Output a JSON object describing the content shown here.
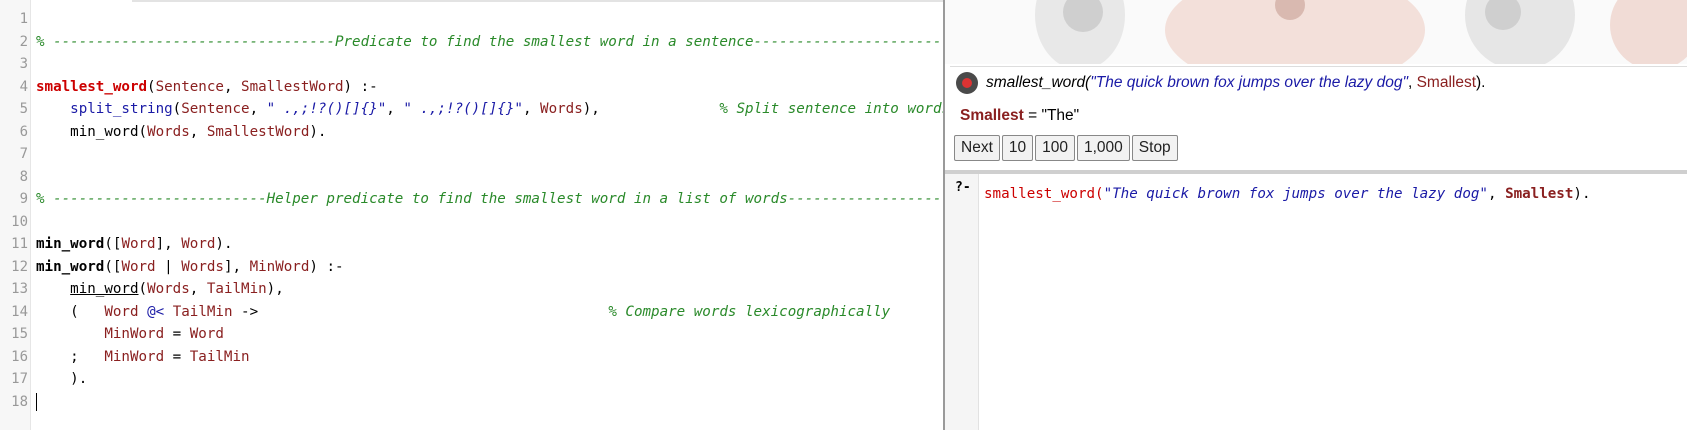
{
  "editor": {
    "lines": [
      {
        "n": "1",
        "segs": []
      },
      {
        "n": "2",
        "segs": [
          {
            "t": "% ---------------------------------Predicate to find the smallest word in a sentence-----------------------------------------",
            "c": "cm"
          }
        ]
      },
      {
        "n": "3",
        "segs": []
      },
      {
        "n": "4",
        "segs": [
          {
            "t": "smallest_word",
            "c": "hd"
          },
          {
            "t": "(",
            "c": "pl"
          },
          {
            "t": "Sentence",
            "c": "var"
          },
          {
            "t": ", ",
            "c": "pl"
          },
          {
            "t": "SmallestWord",
            "c": "var"
          },
          {
            "t": ") :-",
            "c": "pl"
          }
        ]
      },
      {
        "n": "5",
        "segs": [
          {
            "t": "    ",
            "c": "pl"
          },
          {
            "t": "split_string",
            "c": "bi"
          },
          {
            "t": "(",
            "c": "pl"
          },
          {
            "t": "Sentence",
            "c": "var"
          },
          {
            "t": ", ",
            "c": "pl"
          },
          {
            "t": "\" .,;!?()[]{}\"",
            "c": "str"
          },
          {
            "t": ", ",
            "c": "pl"
          },
          {
            "t": "\" .,;!?()[]{}\"",
            "c": "str"
          },
          {
            "t": ", ",
            "c": "pl"
          },
          {
            "t": "Words",
            "c": "var"
          },
          {
            "t": "),              ",
            "c": "pl"
          },
          {
            "t": "% Split sentence into words",
            "c": "cm"
          }
        ]
      },
      {
        "n": "6",
        "segs": [
          {
            "t": "    ",
            "c": "pl"
          },
          {
            "t": "min_word",
            "c": "pl"
          },
          {
            "t": "(",
            "c": "pl"
          },
          {
            "t": "Words",
            "c": "var"
          },
          {
            "t": ", ",
            "c": "pl"
          },
          {
            "t": "SmallestWord",
            "c": "var"
          },
          {
            "t": ").",
            "c": "pl"
          }
        ]
      },
      {
        "n": "7",
        "segs": []
      },
      {
        "n": "8",
        "segs": []
      },
      {
        "n": "9",
        "segs": [
          {
            "t": "% -------------------------Helper predicate to find the smallest word in a list of words-----------------------------------",
            "c": "cm"
          }
        ]
      },
      {
        "n": "10",
        "segs": []
      },
      {
        "n": "11",
        "segs": [
          {
            "t": "min_word",
            "c": "hdb"
          },
          {
            "t": "([",
            "c": "pl"
          },
          {
            "t": "Word",
            "c": "var"
          },
          {
            "t": "], ",
            "c": "pl"
          },
          {
            "t": "Word",
            "c": "var"
          },
          {
            "t": ").",
            "c": "pl"
          }
        ]
      },
      {
        "n": "12",
        "segs": [
          {
            "t": "min_word",
            "c": "hdb"
          },
          {
            "t": "([",
            "c": "pl"
          },
          {
            "t": "Word",
            "c": "var"
          },
          {
            "t": " | ",
            "c": "pl"
          },
          {
            "t": "Words",
            "c": "var"
          },
          {
            "t": "], ",
            "c": "pl"
          },
          {
            "t": "MinWord",
            "c": "var"
          },
          {
            "t": ") :-",
            "c": "pl"
          }
        ]
      },
      {
        "n": "13",
        "segs": [
          {
            "t": "    ",
            "c": "pl"
          },
          {
            "t": "min_word",
            "c": "und"
          },
          {
            "t": "(",
            "c": "pl"
          },
          {
            "t": "Words",
            "c": "var"
          },
          {
            "t": ", ",
            "c": "pl"
          },
          {
            "t": "TailMin",
            "c": "var"
          },
          {
            "t": "),",
            "c": "pl"
          }
        ]
      },
      {
        "n": "14",
        "segs": [
          {
            "t": "    (   ",
            "c": "pl"
          },
          {
            "t": "Word",
            "c": "var"
          },
          {
            "t": " ",
            "c": "pl"
          },
          {
            "t": "@<",
            "c": "bi"
          },
          {
            "t": " ",
            "c": "pl"
          },
          {
            "t": "TailMin",
            "c": "var"
          },
          {
            "t": " ->                                         ",
            "c": "pl"
          },
          {
            "t": "% Compare words lexicographically",
            "c": "cm"
          }
        ]
      },
      {
        "n": "15",
        "segs": [
          {
            "t": "        ",
            "c": "pl"
          },
          {
            "t": "MinWord",
            "c": "var"
          },
          {
            "t": " = ",
            "c": "pl"
          },
          {
            "t": "Word",
            "c": "var"
          }
        ]
      },
      {
        "n": "16",
        "segs": [
          {
            "t": "    ;   ",
            "c": "pl"
          },
          {
            "t": "MinWord",
            "c": "var"
          },
          {
            "t": " = ",
            "c": "pl"
          },
          {
            "t": "TailMin",
            "c": "var"
          }
        ]
      },
      {
        "n": "17",
        "segs": [
          {
            "t": "    ).",
            "c": "pl"
          }
        ]
      },
      {
        "n": "18",
        "segs": [],
        "cursor": true
      }
    ]
  },
  "runner": {
    "query": {
      "head": "smallest_word(",
      "arg_string": "\"The quick brown fox jumps over the lazy dog\"",
      "sep": ", ",
      "var": "Smallest",
      "tail": ")."
    },
    "answer": {
      "var": "Smallest",
      "eq": " = ",
      "value": "\"The\""
    },
    "buttons": [
      "Next",
      "10",
      "100",
      "1,000",
      "Stop"
    ]
  },
  "query_editor": {
    "prompt": "?-",
    "head": "smallest_word(",
    "arg_string": "\"The quick brown fox jumps over the lazy dog\"",
    "sep": ", ",
    "var": "Smallest",
    "tail": ")."
  },
  "colors": {
    "comment": "#2a8a2a",
    "head": "#cc0000",
    "variable": "#8a2020",
    "builtin": "#1a1aa6"
  }
}
